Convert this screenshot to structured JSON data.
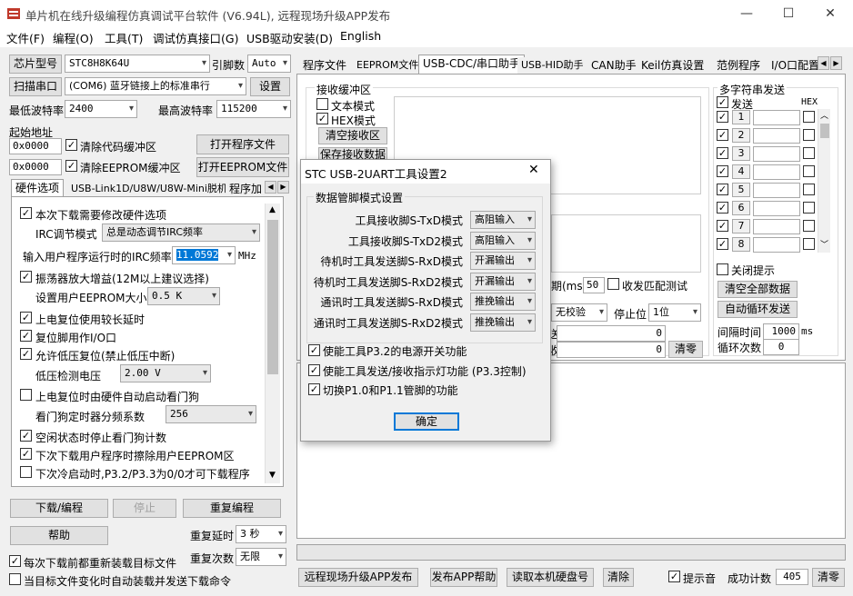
{
  "window": {
    "title": "单片机在线升级编程仿真调试平台软件 (V6.94L), 远程现场升级APP发布",
    "minimize": "—",
    "maximize": "☐",
    "close": "✕"
  },
  "menu": [
    "文件(F)",
    "编程(O)",
    "工具(T)",
    "调试仿真接口(G)",
    "USB驱动安装(D)",
    "English"
  ],
  "left": {
    "chip_label": "芯片型号",
    "chip_value": "STC8H8K64U",
    "pin_label": "引脚数",
    "pin_value": "Auto",
    "scan_label": "扫描串口",
    "port_value": "(COM6) 蓝牙链接上的标准串行",
    "settings_label": "设置",
    "min_baud_label": "最低波特率",
    "min_baud_value": "2400",
    "max_baud_label": "最高波特率",
    "max_baud_value": "115200",
    "start_addr_label": "起始地址",
    "addr1": "0x0000",
    "clear_code_label": "清除代码缓冲区",
    "open_prog_label": "打开程序文件",
    "addr2": "0x0000",
    "clear_eeprom_label": "清除EEPROM缓冲区",
    "open_eeprom_label": "打开EEPROM文件",
    "tabs": [
      "硬件选项",
      "USB-Link1D/U8W/U8W-Mini脱机",
      "程序加"
    ],
    "options": {
      "modify_hw": "本次下载需要修改硬件选项",
      "irc_mode_label": "IRC调节模式",
      "irc_mode_value": "总是动态调节IRC频率",
      "irc_freq_label": "输入用户程序运行时的IRC频率",
      "irc_freq_value": "11.0592",
      "irc_unit": "MHz",
      "osc_gain": "振荡器放大增益(12M以上建议选择)",
      "eeprom_size_label": "设置用户EEPROM大小",
      "eeprom_size_value": "0.5 K",
      "power_reset": "上电复位使用较长延时",
      "reset_io": "复位脚用作I/O口",
      "lvr": "允许低压复位(禁止低压中断)",
      "lvd_label": "低压检测电压",
      "lvd_value": "2.00 V",
      "wdt_auto": "上电复位时由硬件自动启动看门狗",
      "wdt_div_label": "看门狗定时器分频系数",
      "wdt_div_value": "256",
      "idle_wdt": "空闲状态时停止看门狗计数",
      "erase_eeprom": "下次下载用户程序时擦除用户EEPROM区",
      "next_download": "下次冷启动时,P3.2/P3.3为0/0才可下载程序"
    },
    "download_label": "下载/编程",
    "stop_label": "停止",
    "reprogram_label": "重复编程",
    "help_label": "帮助",
    "repeat_delay_label": "重复延时",
    "repeat_delay_value": "3 秒",
    "repeat_count_label": "重复次数",
    "repeat_count_value": "无限",
    "reload_each": "每次下载前都重新装载目标文件",
    "auto_reload": "当目标文件变化时自动装载并发送下载命令"
  },
  "right": {
    "tabs": [
      "程序文件",
      "EEPROM文件",
      "USB-CDC/串口助手",
      "USB-HID助手",
      "CAN助手",
      "Keil仿真设置",
      "范例程序",
      "I/O口配置"
    ],
    "recv_group": "接收缓冲区",
    "text_mode": "文本模式",
    "hex_mode": "HEX模式",
    "clear_recv": "清空接收区",
    "save_recv": "保存接收数据",
    "timeout_suffix": "期(ms)",
    "timeout_value": "50",
    "recv_match": "收发匹配测试",
    "parity_value": "无校验",
    "stop_bit_label": "停止位",
    "stop_bit_value": "1位",
    "count1_suffix": "送",
    "count1_value": "0",
    "count2_suffix": "收",
    "count2_value": "0",
    "clear_count": "清零",
    "multi_group": "多字符串发送",
    "send_label": "发送",
    "hex_label": "HEX",
    "rows": [
      "1",
      "2",
      "3",
      "4",
      "5",
      "6",
      "7",
      "8"
    ],
    "close_hint": "关闭提示",
    "clear_all": "清空全部数据",
    "auto_loop": "自动循环发送",
    "interval_label": "间隔时间",
    "interval_value": "1000",
    "interval_unit": "ms",
    "loop_count_label": "循环次数",
    "loop_count_value": "0"
  },
  "bottom": {
    "remote_upgrade": "远程现场升级APP发布",
    "publish_help": "发布APP帮助",
    "read_disk": "读取本机硬盘号",
    "clear": "清除",
    "beep": "提示音",
    "success_label": "成功计数",
    "success_value": "405",
    "clear_count": "清零"
  },
  "dialog": {
    "title": "STC USB-2UART工具设置2",
    "close": "✕",
    "group": "数据管脚模式设置",
    "rows": [
      {
        "label": "工具接收脚S-TxD模式",
        "value": "高阻输入"
      },
      {
        "label": "工具接收脚S-TxD2模式",
        "value": "高阻输入"
      },
      {
        "label": "待机时工具发送脚S-RxD模式",
        "value": "开漏输出"
      },
      {
        "label": "待机时工具发送脚S-RxD2模式",
        "value": "开漏输出"
      },
      {
        "label": "通讯时工具发送脚S-RxD模式",
        "value": "推挽输出"
      },
      {
        "label": "通讯时工具发送脚S-RxD2模式",
        "value": "推挽输出"
      }
    ],
    "opt1": "使能工具P3.2的电源开关功能",
    "opt2": "使能工具发送/接收指示灯功能 (P3.3控制)",
    "opt3": "切换P1.0和P1.1管脚的功能",
    "ok": "确定"
  }
}
